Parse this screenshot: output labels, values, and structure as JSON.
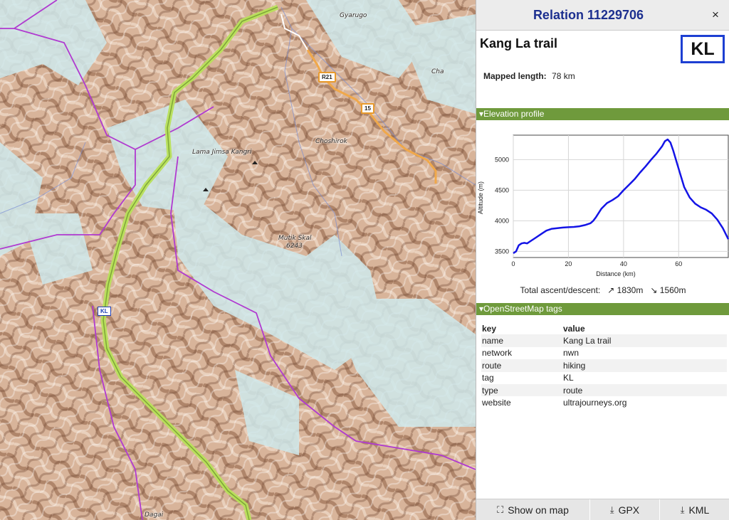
{
  "map": {
    "labels": {
      "gyarugo": "Gyarugo",
      "cha": "Cha",
      "choshirok": "Choshirok",
      "lama_jimsa_kangri": "Lama Jimsa Kangri",
      "mutik_skal": "Mutik Skal",
      "mutik_skal_ele": "6243",
      "dagai": "Dagai"
    },
    "road_shields": {
      "r21": "R21",
      "r15": "15"
    },
    "route_badge": "KL"
  },
  "panel": {
    "title": "Relation 11229706",
    "close": "×",
    "route_name": "Kang La trail",
    "ref": "KL",
    "mapped_length_label": "Mapped length:",
    "mapped_length_value": "78 km",
    "elevation_header": "▾Elevation profile",
    "ascent_label": "Total ascent/descent:",
    "ascent_value": "↗ 1830m",
    "descent_value": "↘ 1560m",
    "tags_header": "▾OpenStreetMap tags",
    "tags_columns": [
      "key",
      "value"
    ],
    "tags": [
      [
        "name",
        "Kang La trail"
      ],
      [
        "network",
        "nwn"
      ],
      [
        "route",
        "hiking"
      ],
      [
        "tag",
        "KL"
      ],
      [
        "type",
        "route"
      ],
      [
        "website",
        "ultrajourneys.org"
      ]
    ],
    "footer": {
      "show_on_map": "Show on map",
      "gpx": "GPX",
      "kml": "KML"
    }
  },
  "chart_data": {
    "type": "line",
    "xlabel": "Distance (km)",
    "ylabel": "Altitude (m)",
    "xlim": [
      0,
      78
    ],
    "ylim": [
      3400,
      5400
    ],
    "xticks": [
      0,
      20,
      40,
      60
    ],
    "yticks": [
      3500,
      4000,
      4500,
      5000
    ],
    "grid": true,
    "line_color": "#1414e6",
    "x": [
      0,
      1,
      2,
      3,
      4,
      5,
      6,
      8,
      10,
      12,
      14,
      16,
      18,
      20,
      22,
      24,
      26,
      28,
      29,
      30,
      32,
      34,
      36,
      38,
      40,
      42,
      44,
      46,
      48,
      50,
      52,
      54,
      55,
      56,
      57,
      58,
      60,
      62,
      64,
      66,
      68,
      70,
      72,
      74,
      76,
      78
    ],
    "y": [
      3470,
      3500,
      3600,
      3630,
      3640,
      3630,
      3660,
      3720,
      3780,
      3840,
      3870,
      3880,
      3890,
      3895,
      3900,
      3910,
      3930,
      3960,
      4000,
      4060,
      4200,
      4290,
      4340,
      4400,
      4500,
      4590,
      4680,
      4790,
      4890,
      5000,
      5100,
      5220,
      5300,
      5330,
      5280,
      5150,
      4850,
      4550,
      4380,
      4280,
      4220,
      4180,
      4120,
      4020,
      3880,
      3700
    ]
  }
}
